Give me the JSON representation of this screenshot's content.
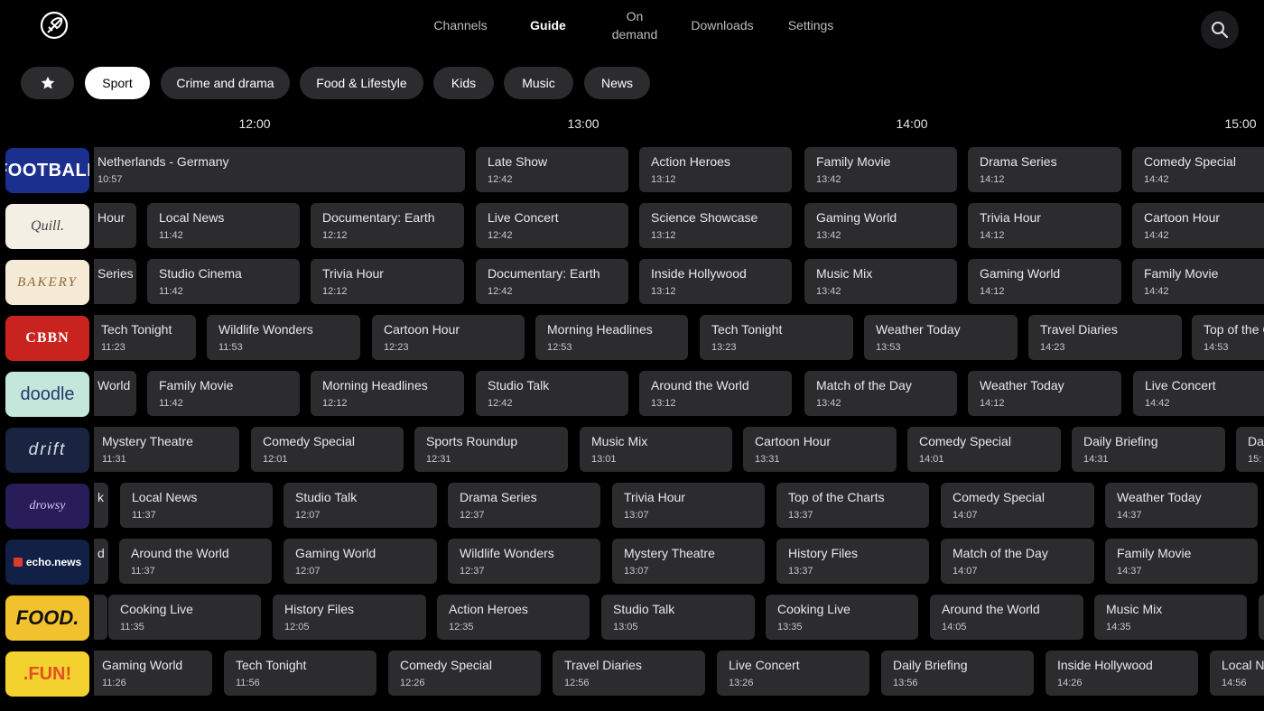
{
  "nav": {
    "items": [
      {
        "label": "Channels"
      },
      {
        "label": "Guide"
      },
      {
        "label": "On demand"
      },
      {
        "label": "Downloads"
      },
      {
        "label": "Settings"
      }
    ]
  },
  "filters": [
    "Sport",
    "Crime and drama",
    "Food & Lifestyle",
    "Kids",
    "Music",
    "News"
  ],
  "timeline": [
    "12:00",
    "13:00",
    "14:00",
    "15:00"
  ],
  "channels": [
    {
      "logo": "FOOTBALL",
      "bg": "#1b2f8f",
      "fg": "#ffffff",
      "programs": [
        {
          "title": "Netherlands - Germany",
          "time": "10:57"
        },
        {
          "title": "Late Show",
          "time": "12:42"
        },
        {
          "title": "Action Heroes",
          "time": "13:12"
        },
        {
          "title": "Family Movie",
          "time": "13:42"
        },
        {
          "title": "Drama Series",
          "time": "14:12"
        },
        {
          "title": "Comedy Special",
          "time": "14:42"
        }
      ]
    },
    {
      "logo": "Quill.",
      "bg": "#f3efe4",
      "fg": "#444444",
      "programs": [
        {
          "title": "Hour",
          "time": ""
        },
        {
          "title": "Local News",
          "time": "11:42"
        },
        {
          "title": "Documentary: Earth",
          "time": "12:12"
        },
        {
          "title": "Live Concert",
          "time": "12:42"
        },
        {
          "title": "Science Showcase",
          "time": "13:12"
        },
        {
          "title": "Gaming World",
          "time": "13:42"
        },
        {
          "title": "Trivia Hour",
          "time": "14:12"
        },
        {
          "title": "Cartoon Hour",
          "time": "14:42"
        }
      ]
    },
    {
      "logo": "BAKERY",
      "bg": "#f4ead6",
      "fg": "#8a6a3a",
      "programs": [
        {
          "title": "Series",
          "time": ""
        },
        {
          "title": "Studio Cinema",
          "time": "11:42"
        },
        {
          "title": "Trivia Hour",
          "time": "12:12"
        },
        {
          "title": "Documentary: Earth",
          "time": "12:42"
        },
        {
          "title": "Inside Hollywood",
          "time": "13:12"
        },
        {
          "title": "Music Mix",
          "time": "13:42"
        },
        {
          "title": "Gaming World",
          "time": "14:12"
        },
        {
          "title": "Family Movie",
          "time": "14:42"
        }
      ]
    },
    {
      "logo": "CBBN",
      "bg": "#c8231f",
      "fg": "#ffffff",
      "programs": [
        {
          "title": "Tech Tonight",
          "time": "11:23"
        },
        {
          "title": "Wildlife Wonders",
          "time": "11:53"
        },
        {
          "title": "Cartoon Hour",
          "time": "12:23"
        },
        {
          "title": "Morning Headlines",
          "time": "12:53"
        },
        {
          "title": "Tech Tonight",
          "time": "13:23"
        },
        {
          "title": "Weather Today",
          "time": "13:53"
        },
        {
          "title": "Travel Diaries",
          "time": "14:23"
        },
        {
          "title": "Top of the C",
          "time": "14:53"
        }
      ]
    },
    {
      "logo": "doodle",
      "bg": "#c4e7dc",
      "fg": "#1d3a6b",
      "programs": [
        {
          "title": "World",
          "time": ""
        },
        {
          "title": "Family Movie",
          "time": "11:42"
        },
        {
          "title": "Morning Headlines",
          "time": "12:12"
        },
        {
          "title": "Studio Talk",
          "time": "12:42"
        },
        {
          "title": "Around the World",
          "time": "13:12"
        },
        {
          "title": "Match of the Day",
          "time": "13:42"
        },
        {
          "title": "Weather Today",
          "time": "14:12"
        },
        {
          "title": "Live Concert",
          "time": "14:42"
        }
      ]
    },
    {
      "logo": "drift",
      "bg": "#1a2440",
      "fg": "#d6dde8",
      "programs": [
        {
          "title": "Mystery Theatre",
          "time": "11:31"
        },
        {
          "title": "Comedy Special",
          "time": "12:01"
        },
        {
          "title": "Sports Roundup",
          "time": "12:31"
        },
        {
          "title": "Music Mix",
          "time": "13:01"
        },
        {
          "title": "Cartoon Hour",
          "time": "13:31"
        },
        {
          "title": "Comedy Special",
          "time": "14:01"
        },
        {
          "title": "Daily Briefing",
          "time": "14:31"
        },
        {
          "title": "Da",
          "time": "15:"
        }
      ]
    },
    {
      "logo": "drowsy",
      "bg": "#281d58",
      "fg": "#cfc6f3",
      "programs": [
        {
          "title": "k",
          "time": ""
        },
        {
          "title": "Local News",
          "time": "11:37"
        },
        {
          "title": "Studio Talk",
          "time": "12:07"
        },
        {
          "title": "Drama Series",
          "time": "12:37"
        },
        {
          "title": "Trivia Hour",
          "time": "13:07"
        },
        {
          "title": "Top of the Charts",
          "time": "13:37"
        },
        {
          "title": "Comedy Special",
          "time": "14:07"
        },
        {
          "title": "Weather Today",
          "time": "14:37"
        }
      ]
    },
    {
      "logo": "echo.news",
      "bg": "#132046",
      "fg": "#ffffff",
      "programs": [
        {
          "title": "d",
          "time": ""
        },
        {
          "title": "Around the World",
          "time": "11:37"
        },
        {
          "title": "Gaming World",
          "time": "12:07"
        },
        {
          "title": "Wildlife Wonders",
          "time": "12:37"
        },
        {
          "title": "Mystery Theatre",
          "time": "13:07"
        },
        {
          "title": "History Files",
          "time": "13:37"
        },
        {
          "title": "Match of the Day",
          "time": "14:07"
        },
        {
          "title": "Family Movie",
          "time": "14:37"
        }
      ]
    },
    {
      "logo": "FOOD.",
      "bg": "#f2c12e",
      "fg": "#111111",
      "programs": [
        {
          "title": "",
          "time": ""
        },
        {
          "title": "Cooking Live",
          "time": "11:35"
        },
        {
          "title": "History Files",
          "time": "12:05"
        },
        {
          "title": "Action Heroes",
          "time": "12:35"
        },
        {
          "title": "Studio Talk",
          "time": "13:05"
        },
        {
          "title": "Cooking Live",
          "time": "13:35"
        },
        {
          "title": "Around the World",
          "time": "14:05"
        },
        {
          "title": "Music Mix",
          "time": "14:35"
        },
        {
          "title": "",
          "time": ""
        }
      ]
    },
    {
      "logo": ".FUN!",
      "bg": "#f3d12f",
      "fg": "#e0521f",
      "programs": [
        {
          "title": "Gaming World",
          "time": "11:26"
        },
        {
          "title": "Tech Tonight",
          "time": "11:56"
        },
        {
          "title": "Comedy Special",
          "time": "12:26"
        },
        {
          "title": "Travel Diaries",
          "time": "12:56"
        },
        {
          "title": "Live Concert",
          "time": "13:26"
        },
        {
          "title": "Daily Briefing",
          "time": "13:56"
        },
        {
          "title": "Inside Hollywood",
          "time": "14:26"
        },
        {
          "title": "Local N",
          "time": "14:56"
        }
      ]
    }
  ]
}
